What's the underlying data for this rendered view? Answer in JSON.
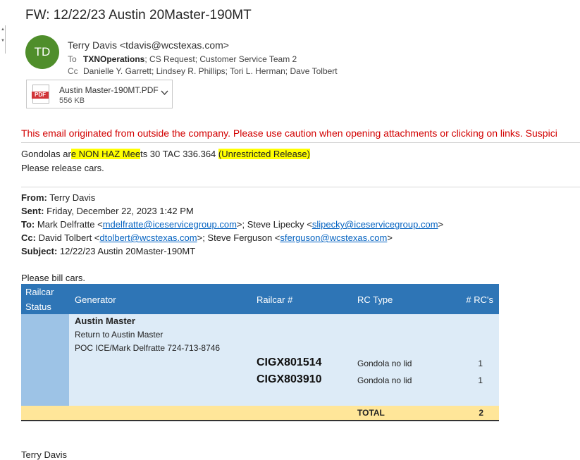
{
  "email": {
    "subject": "FW: 12/22/23 Austin 20Master-190MT",
    "avatar_initials": "TD",
    "avatar_color": "#4f8e2b",
    "sender": "Terry Davis <tdavis@wcstexas.com>",
    "to_label": "To",
    "to_bold": "TXNOperations",
    "to_rest": "; CS Request; Customer Service Team 2",
    "cc_label": "Cc",
    "cc": "Danielle Y. Garrett; Lindsey R. Phillips; Tori L. Herman; Dave Tolbert",
    "attachment": {
      "icon": "pdf-icon",
      "icon_label": "PDF",
      "name": "Austin Master-190MT.PDF",
      "size": "556 KB"
    },
    "warning": "This email originated from outside the company. Please use caution when opening attachments or clicking on links. Suspici"
  },
  "body": {
    "line1_a": "Gondolas ar",
    "line1_b": "e NON HAZ Mee",
    "line1_c": "ts 30 TAC 336.364 ",
    "line1_d": "(Unrestricted Release)",
    "line2": "Please release cars.",
    "fwd": {
      "from_label": "From:",
      "from": " Terry Davis",
      "sent_label": "Sent:",
      "sent": " Friday, December 22, 2023 1:42 PM",
      "to_label": "To:",
      "to_1": " Mark Delfratte <",
      "to_1_link": "mdelfratte@iceservicegroup.com",
      "to_2": ">; Steve Lipecky <",
      "to_2_link": "slipecky@iceservicegroup.com",
      "to_3": ">",
      "cc_label": "Cc:",
      "cc_1": " David Tolbert <",
      "cc_1_link": "dtolbert@wcstexas.com",
      "cc_2": ">; Steve Ferguson <",
      "cc_2_link": "sferguson@wcstexas.com",
      "cc_3": ">",
      "subject_label": "Subject:",
      "subject": " 12/22/23 Austin 20Master-190MT"
    },
    "bill_line": "Please bill cars.",
    "signature": "Terry Davis"
  },
  "table": {
    "headers": {
      "status_1": "Railcar",
      "status_2": "Status",
      "generator": "Generator",
      "railcar": "Railcar #",
      "rctype": "RC Type",
      "count": "# RC's"
    },
    "generator_name": "Austin Master",
    "generator_line2": "Return to Austin Master",
    "generator_line3": "POC ICE/Mark Delfratte 724-713-8746",
    "rows": [
      {
        "railcar": "CIGX801514",
        "type": "Gondola no lid",
        "count": "1"
      },
      {
        "railcar": "CIGX803910",
        "type": "Gondola no lid",
        "count": "1"
      }
    ],
    "total_label": "TOTAL",
    "total_value": "2",
    "header_color": "#2e75b6",
    "total_color": "#ffe699"
  }
}
